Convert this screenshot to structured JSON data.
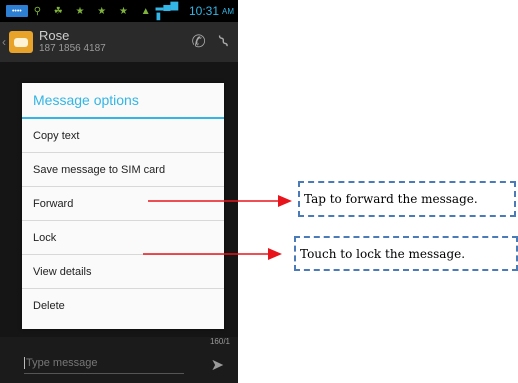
{
  "status_bar": {
    "notification": "••••",
    "time": "10:31",
    "ampm": "AM"
  },
  "header": {
    "contact_name": "Rose",
    "contact_number": "187 1856 4187"
  },
  "dialog": {
    "title": "Message options",
    "items": [
      {
        "label": "Copy text"
      },
      {
        "label": "Save message to SIM card"
      },
      {
        "label": "Forward"
      },
      {
        "label": "Lock"
      },
      {
        "label": "View details"
      },
      {
        "label": "Delete"
      }
    ]
  },
  "compose": {
    "char_count": "160/1",
    "placeholder": "Type message"
  },
  "annotations": {
    "forward": "Tap to forward the message.",
    "lock": "Touch to lock the message.",
    "arrow_color": "#e8141c",
    "border_color": "#4a7ab8"
  },
  "icons": {
    "phone": "phone-icon",
    "attach": "paperclip-icon",
    "send": "send-icon"
  },
  "colors": {
    "accent": "#33b5e5",
    "dialog_bg": "#fafafa",
    "screen_bg": "#151515"
  }
}
